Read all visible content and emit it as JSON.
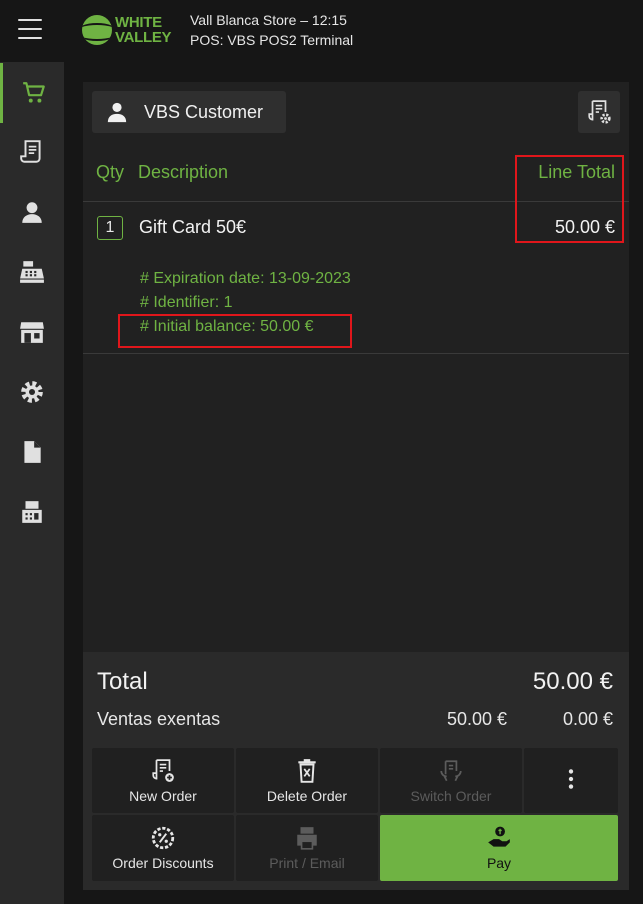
{
  "header": {
    "logo_line1": "WHITE",
    "logo_line2": "VALLEY",
    "store_line": "Vall Blanca Store – 12:15",
    "terminal_line": "POS: VBS POS2 Terminal"
  },
  "sidebar": {
    "items": [
      {
        "icon": "cart-icon",
        "active": true
      },
      {
        "icon": "receipt-icon",
        "active": false
      },
      {
        "icon": "user-icon",
        "active": false
      },
      {
        "icon": "cash-register-icon",
        "active": false
      },
      {
        "icon": "store-icon",
        "active": false
      },
      {
        "icon": "gear-icon",
        "active": false
      },
      {
        "icon": "document-icon",
        "active": false
      },
      {
        "icon": "fax-icon",
        "active": false
      }
    ]
  },
  "order": {
    "customer": "VBS Customer",
    "columns": {
      "qty": "Qty",
      "description": "Description",
      "line_total": "Line Total"
    },
    "lines": [
      {
        "qty": "1",
        "description": "Gift Card 50€",
        "total": "50.00 €",
        "attributes": [
          "# Expiration date: 13-09-2023",
          "# Identifier: 1",
          "# Initial balance: 50.00 €"
        ]
      }
    ]
  },
  "totals": {
    "label": "Total",
    "value": "50.00 €",
    "tax_name": "Ventas exentas",
    "tax_base": "50.00 €",
    "tax_amount": "0.00 €"
  },
  "actions": {
    "new_order": "New Order",
    "delete_order": "Delete Order",
    "switch_order": "Switch Order",
    "order_discounts": "Order Discounts",
    "print_email": "Print / Email",
    "pay": "Pay"
  },
  "colors": {
    "accent": "#6fb343",
    "highlight": "#e0161b",
    "background": "#161616",
    "panel": "#212121"
  }
}
